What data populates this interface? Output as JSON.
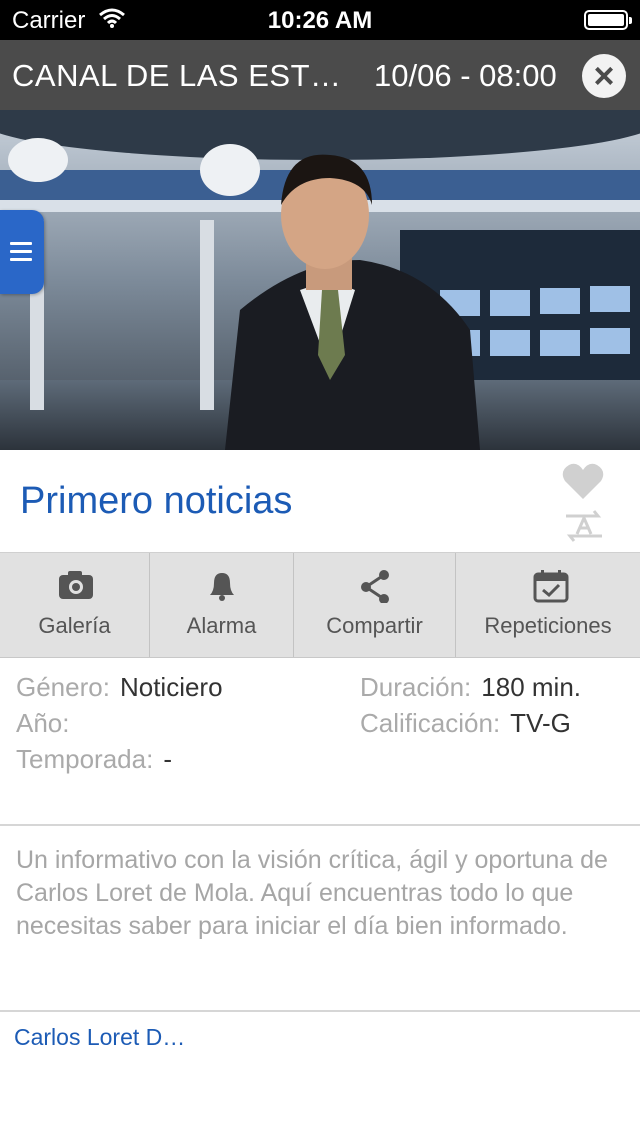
{
  "status_bar": {
    "carrier": "Carrier",
    "time": "10:26 AM"
  },
  "header": {
    "channel": "CANAL DE LAS EST…",
    "datetime": "10/06 - 08:00",
    "close_icon": "close-icon"
  },
  "program": {
    "title": "Primero noticias",
    "favorite_icon": "heart-icon",
    "language_icon": "translate-icon"
  },
  "actions": [
    {
      "label": "Galería",
      "icon": "camera-icon"
    },
    {
      "label": "Alarma",
      "icon": "bell-icon"
    },
    {
      "label": "Compartir",
      "icon": "share-icon"
    },
    {
      "label": "Repeticiones",
      "icon": "calendar-check-icon"
    }
  ],
  "details": {
    "genre_label": "Género:",
    "genre_value": "Noticiero",
    "year_label": "Año:",
    "year_value": "",
    "season_label": "Temporada:",
    "season_value": "-",
    "duration_label": "Duración:",
    "duration_value": "180 min.",
    "rating_label": "Calificación:",
    "rating_value": "TV-G"
  },
  "description": "Un informativo con la visión crítica, ágil y oportuna de Carlos Loret de Mola. Aquí encuentras todo lo que necesitas saber para iniciar el día bien informado.",
  "cast_link": "Carlos Loret D…",
  "colors": {
    "accent": "#1c5bb5",
    "titlebar": "#4b4b4b",
    "menu_tab": "#2a67c8"
  }
}
